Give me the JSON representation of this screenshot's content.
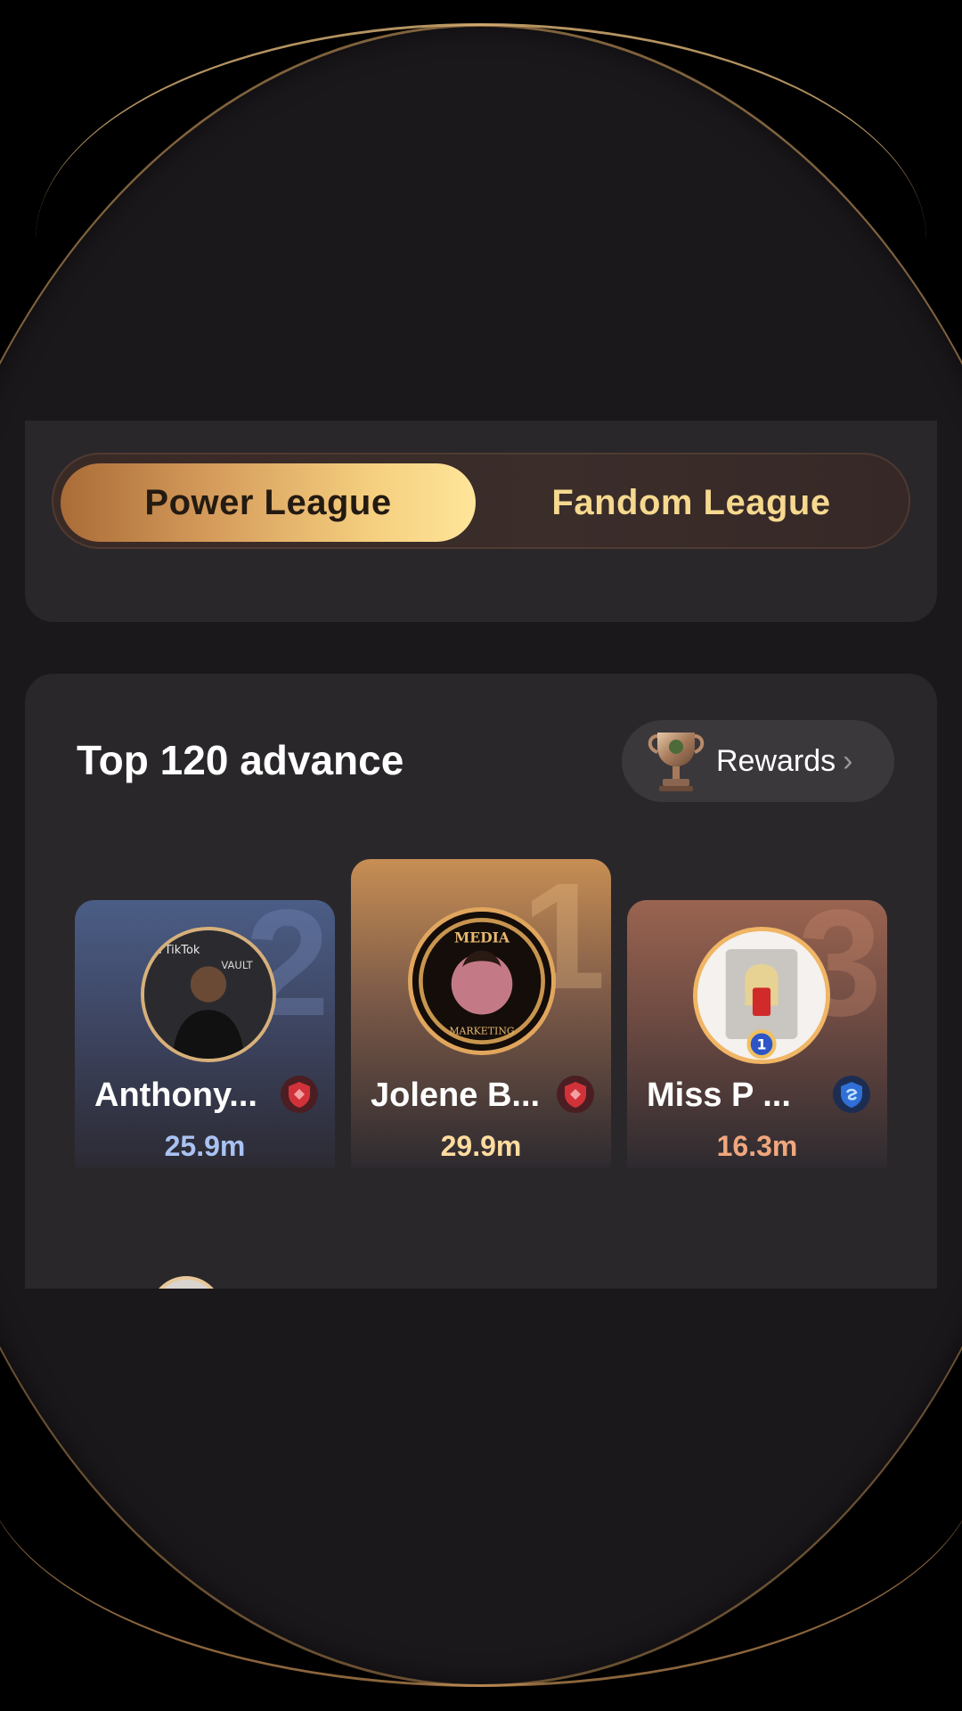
{
  "league_switch": {
    "tabs": [
      {
        "label": "Power League",
        "active": true
      },
      {
        "label": "Fandom League",
        "active": false
      }
    ]
  },
  "leaderboard": {
    "title": "Top 120 advance",
    "rewards_label": "Rewards",
    "podium": [
      {
        "rank": "2",
        "name": "Anthony...",
        "score": "25.9m",
        "badge": "red-shield-icon"
      },
      {
        "rank": "1",
        "name": "Jolene B...",
        "score": "29.9m",
        "badge": "red-shield-icon"
      },
      {
        "rank": "3",
        "name": "Miss P ...",
        "score": "16.3m",
        "badge": "blue-shield-icon"
      }
    ]
  },
  "colors": {
    "accent_gold": "#f5cf7f",
    "rank1_score": "#ffdca0",
    "rank2_score": "#a9c2f2",
    "rank3_score": "#f0a77e"
  }
}
